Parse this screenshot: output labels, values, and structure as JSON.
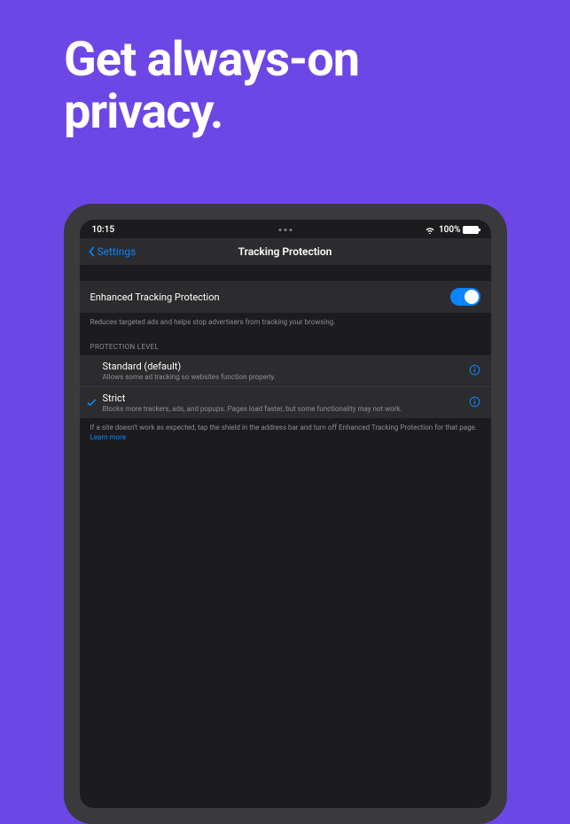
{
  "headline": "Get always-on privacy.",
  "statusBar": {
    "time": "10:15",
    "batteryPct": "100%"
  },
  "nav": {
    "back": "Settings",
    "title": "Tracking Protection"
  },
  "toggle": {
    "label": "Enhanced Tracking Protection",
    "on": true,
    "description": "Reduces targeted ads and helps stop advertisers from tracking your browsing."
  },
  "protectionLevel": {
    "header": "PROTECTION LEVEL",
    "options": [
      {
        "selected": false,
        "title": "Standard (default)",
        "subtitle": "Allows some ad tracking so websites function properly."
      },
      {
        "selected": true,
        "title": "Strict",
        "subtitle": "Blocks more trackers, ads, and popups. Pages load faster, but some functionality may not work."
      }
    ],
    "footer": "If a site doesn't work as expected, tap the shield in the address bar and turn off Enhanced Tracking Protection for that page.",
    "learnMore": "Learn more"
  }
}
